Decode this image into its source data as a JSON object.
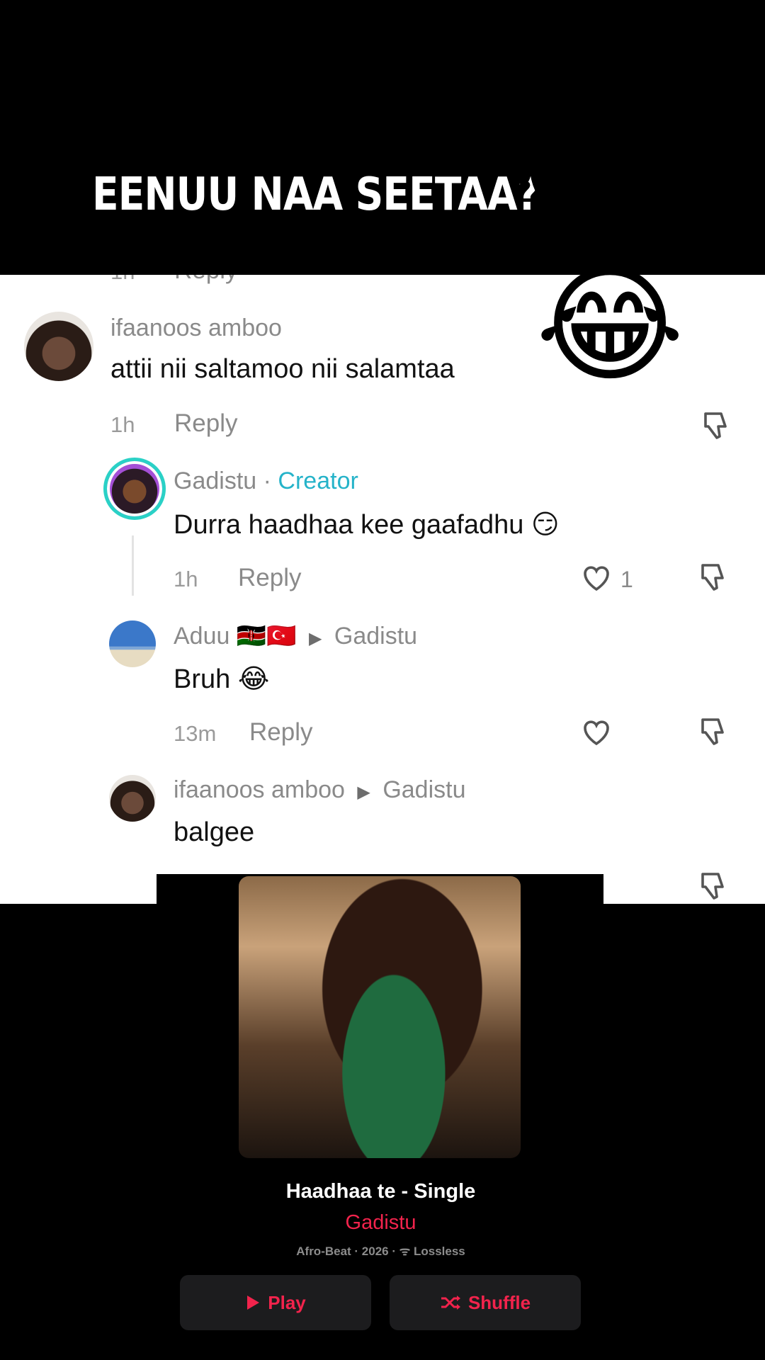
{
  "overlay": {
    "headline": "EENUU NAA SEETAA?",
    "emoji_icon": "😂"
  },
  "comments": [
    {
      "username": "ifaanoos amboo",
      "text": "attii nii saltamoo nii salamtaa",
      "time": "1h",
      "reply_label": "Reply"
    },
    {
      "username": "Gadistu",
      "badge": "Creator",
      "text": "Durra haadhaa kee gaafadhu 😏",
      "time": "1h",
      "reply_label": "Reply",
      "likes": "1"
    },
    {
      "username": "Aduu 🇰🇪🇹🇷",
      "reply_to": "Gadistu",
      "text": "Bruh 😂",
      "time": "13m",
      "reply_label": "Reply"
    },
    {
      "username": "ifaanoos amboo",
      "reply_to": "Gadistu",
      "text": "balgee"
    }
  ],
  "album": {
    "title": "Haadhaa te - Single",
    "artist": "Gadistu",
    "meta": "Afro-Beat · 2026 · ᯤ Lossless",
    "play_label": "Play",
    "shuffle_label": "Shuffle",
    "play_icon": "play-icon",
    "shuffle_icon": "shuffle-icon",
    "accent_color": "#f2234c"
  }
}
